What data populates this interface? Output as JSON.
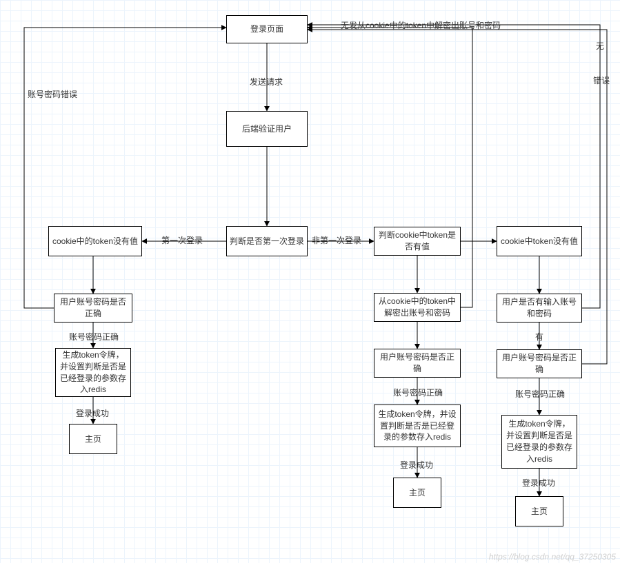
{
  "chart_data": {
    "type": "flowchart",
    "nodes": [
      {
        "id": "login_page",
        "label": "登录页面"
      },
      {
        "id": "backend_verify",
        "label": "后端验证用户"
      },
      {
        "id": "is_first_login",
        "label": "判断是否第一次登录"
      },
      {
        "id": "cookie_token_no_val_left",
        "label": "cookie中的token没有值"
      },
      {
        "id": "user_pw_correct_left",
        "label": "用户账号密码是否正确"
      },
      {
        "id": "gen_token_left",
        "label": "生成token令牌，并设置判断是否是已经登录的参数存入redis"
      },
      {
        "id": "home_left",
        "label": "主页"
      },
      {
        "id": "has_token_mid",
        "label": "判断cookie中token是否有值"
      },
      {
        "id": "decrypt_token",
        "label": "从cookie中的token中解密出账号和密码"
      },
      {
        "id": "user_pw_correct_mid",
        "label": "用户账号密码是否正确"
      },
      {
        "id": "gen_token_mid",
        "label": "生成token令牌，并设置判断是否是已经登录的参数存入redis"
      },
      {
        "id": "home_mid",
        "label": "主页"
      },
      {
        "id": "cookie_token_no_val_right",
        "label": "cookie中token没有值"
      },
      {
        "id": "user_has_input",
        "label": "用户是否有输入账号和密码"
      },
      {
        "id": "user_pw_correct_right",
        "label": "用户账号密码是否正确"
      },
      {
        "id": "gen_token_right",
        "label": "生成token令牌，并设置判断是否是已经登录的参数存入redis"
      },
      {
        "id": "home_right",
        "label": "主页"
      }
    ],
    "edges": [
      {
        "from": "login_page",
        "to": "backend_verify",
        "label": "发送请求"
      },
      {
        "from": "backend_verify",
        "to": "is_first_login"
      },
      {
        "from": "is_first_login",
        "to": "cookie_token_no_val_left",
        "label": "第一次登录"
      },
      {
        "from": "is_first_login",
        "to": "has_token_mid",
        "label": "非第一次登录"
      },
      {
        "from": "cookie_token_no_val_left",
        "to": "user_pw_correct_left"
      },
      {
        "from": "user_pw_correct_left",
        "to": "gen_token_left",
        "label": "账号密码正确"
      },
      {
        "from": "user_pw_correct_left",
        "to": "login_page",
        "label": "账号密码错误"
      },
      {
        "from": "gen_token_left",
        "to": "home_left",
        "label": "登录成功"
      },
      {
        "from": "has_token_mid",
        "to": "decrypt_token"
      },
      {
        "from": "has_token_mid",
        "to": "cookie_token_no_val_right"
      },
      {
        "from": "decrypt_token",
        "to": "user_pw_correct_mid"
      },
      {
        "from": "decrypt_token",
        "to": "login_page",
        "label": "无发从cookie中的token中解密出账号和密码"
      },
      {
        "from": "user_pw_correct_mid",
        "to": "gen_token_mid",
        "label": "账号密码正确"
      },
      {
        "from": "gen_token_mid",
        "to": "home_mid",
        "label": "登录成功"
      },
      {
        "from": "cookie_token_no_val_right",
        "to": "user_has_input"
      },
      {
        "from": "user_has_input",
        "to": "user_pw_correct_right",
        "label": "有"
      },
      {
        "from": "user_has_input",
        "to": "login_page",
        "label": "无"
      },
      {
        "from": "user_pw_correct_right",
        "to": "gen_token_right",
        "label": "账号密码正确"
      },
      {
        "from": "user_pw_correct_right",
        "to": "login_page",
        "label": "错误"
      },
      {
        "from": "gen_token_right",
        "to": "home_right",
        "label": "登录成功"
      }
    ]
  },
  "labels": {
    "send_request": "发送请求",
    "first_login": "第一次登录",
    "not_first_login": "非第一次登录",
    "pw_wrong": "账号密码错误",
    "pw_right_l": "账号密码正确",
    "pw_right_m": "账号密码正确",
    "pw_right_r": "账号密码正确",
    "login_ok_l": "登录成功",
    "login_ok_m": "登录成功",
    "login_ok_r": "登录成功",
    "has": "有",
    "none": "无",
    "error": "错误",
    "decrypt_fail": "无发从cookie中的token中解密出账号和密码"
  },
  "watermark": "https://blog.csdn.net/qq_37250305"
}
